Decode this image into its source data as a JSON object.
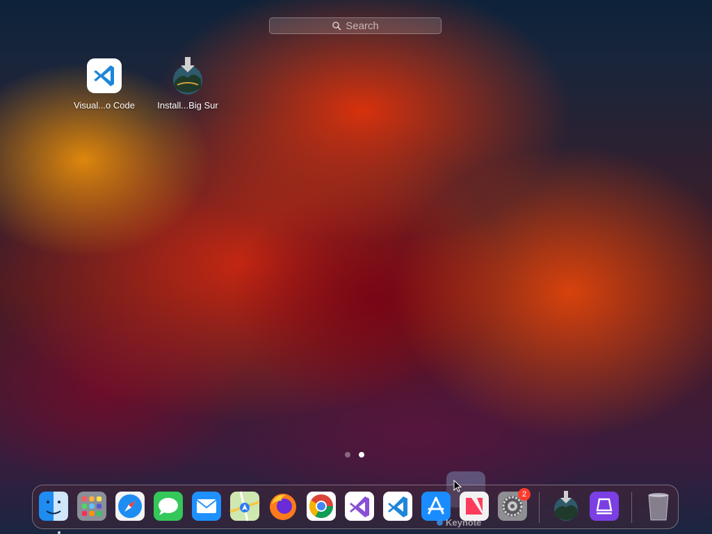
{
  "search": {
    "placeholder": "Search",
    "icon": "search-icon"
  },
  "launchpad_apps": [
    {
      "label": "Visual...o Code",
      "icon": "vscode-icon"
    },
    {
      "label": "Install...Big Sur",
      "icon": "macos-installer-icon"
    }
  ],
  "pages": {
    "count": 2,
    "current": 2
  },
  "dock": {
    "items": [
      {
        "name": "Finder",
        "icon": "finder-icon",
        "running": true
      },
      {
        "name": "Launchpad",
        "icon": "launchpad-icon"
      },
      {
        "name": "Safari",
        "icon": "safari-icon"
      },
      {
        "name": "Messages",
        "icon": "messages-icon"
      },
      {
        "name": "Mail",
        "icon": "mail-icon"
      },
      {
        "name": "Maps",
        "icon": "maps-icon"
      },
      {
        "name": "Firefox",
        "icon": "firefox-icon"
      },
      {
        "name": "Chrome",
        "icon": "chrome-icon"
      },
      {
        "name": "Visual Studio",
        "icon": "visual-studio-icon"
      },
      {
        "name": "Visual Studio Code",
        "icon": "vscode-icon"
      },
      {
        "name": "App Store",
        "icon": "app-store-icon"
      },
      {
        "name": "News",
        "icon": "news-icon"
      },
      {
        "name": "System Preferences",
        "icon": "settings-gear-icon",
        "badge": "2"
      },
      {
        "name": "Install macOS Big Sur",
        "icon": "macos-installer-icon"
      },
      {
        "name": "Podcast app",
        "icon": "purple-app-icon"
      },
      {
        "name": "Trash",
        "icon": "trash-icon"
      }
    ],
    "drag_label": "Keynote"
  },
  "colors": {
    "accent": "#007aff",
    "badge": "#ff3b30"
  }
}
